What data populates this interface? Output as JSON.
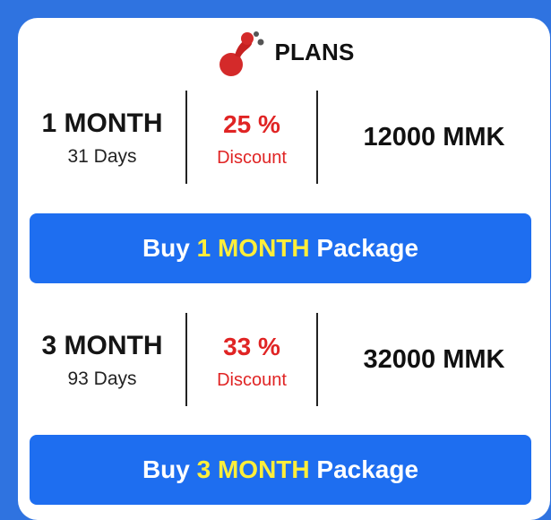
{
  "header": {
    "title": "PLANS",
    "logo_icon": "app-logo-icon",
    "logo_color": "#d42a2a"
  },
  "plans": [
    {
      "name": "1 MONTH",
      "days": "31 Days",
      "discount_percent": "25 %",
      "discount_label": "Discount",
      "price": "12000 MMK",
      "button": {
        "prefix": "Buy ",
        "highlight": "1 MONTH",
        "suffix": " Package"
      }
    },
    {
      "name": "3 MONTH",
      "days": "93 Days",
      "discount_percent": "33 %",
      "discount_label": "Discount",
      "price": "32000 MMK",
      "button": {
        "prefix": "Buy ",
        "highlight": "3 MONTH",
        "suffix": " Package"
      }
    }
  ],
  "colors": {
    "background": "#2f73e0",
    "button": "#1e6ef0",
    "button_highlight": "#ffee3a",
    "discount": "#e02424"
  }
}
